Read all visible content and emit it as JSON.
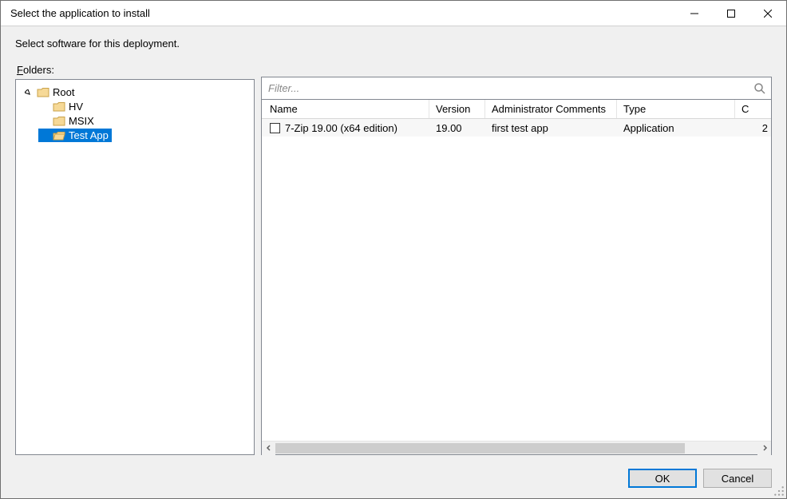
{
  "window": {
    "title": "Select the application to install"
  },
  "instruction": "Select software for this deployment.",
  "folders_label_pre": "F",
  "folders_label_rest": "olders:",
  "tree": {
    "root": "Root",
    "children": [
      "HV",
      "MSIX",
      "Test App"
    ],
    "selected": "Test App"
  },
  "filter": {
    "placeholder": "Filter..."
  },
  "table": {
    "columns": [
      "Name",
      "Version",
      "Administrator Comments",
      "Type",
      "C"
    ],
    "rows": [
      {
        "name": "7-Zip 19.00 (x64 edition)",
        "version": "19.00",
        "admin": "first test app",
        "type": "Application",
        "last": "2"
      }
    ]
  },
  "buttons": {
    "ok": "OK",
    "cancel": "Cancel"
  }
}
